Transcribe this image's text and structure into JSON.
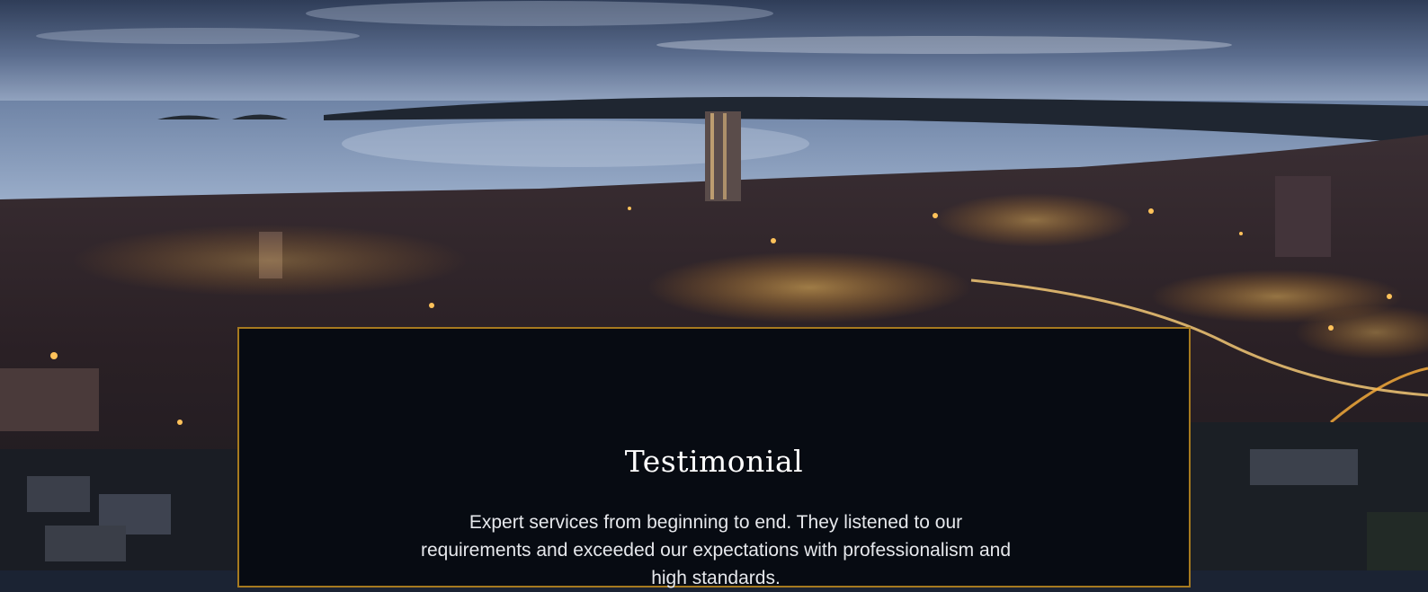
{
  "hero": {
    "image": "night-city-harbour-skyline",
    "colors": {
      "sky_top": "#2c3a55",
      "sky_bottom": "#9aa8c2",
      "sea": "#7f93b3",
      "hills": "#1e2530",
      "city": "#241b20",
      "lights": "#ffb13b"
    }
  },
  "testimonial": {
    "title": "Testimonial",
    "quote": "Expert services from beginning to end. They listened to our requirements and exceeded our expectations with",
    "quote_cutoff": "professionalism and high standards.",
    "panel_bg": "#070b12",
    "border_color": "#a67a1f"
  }
}
